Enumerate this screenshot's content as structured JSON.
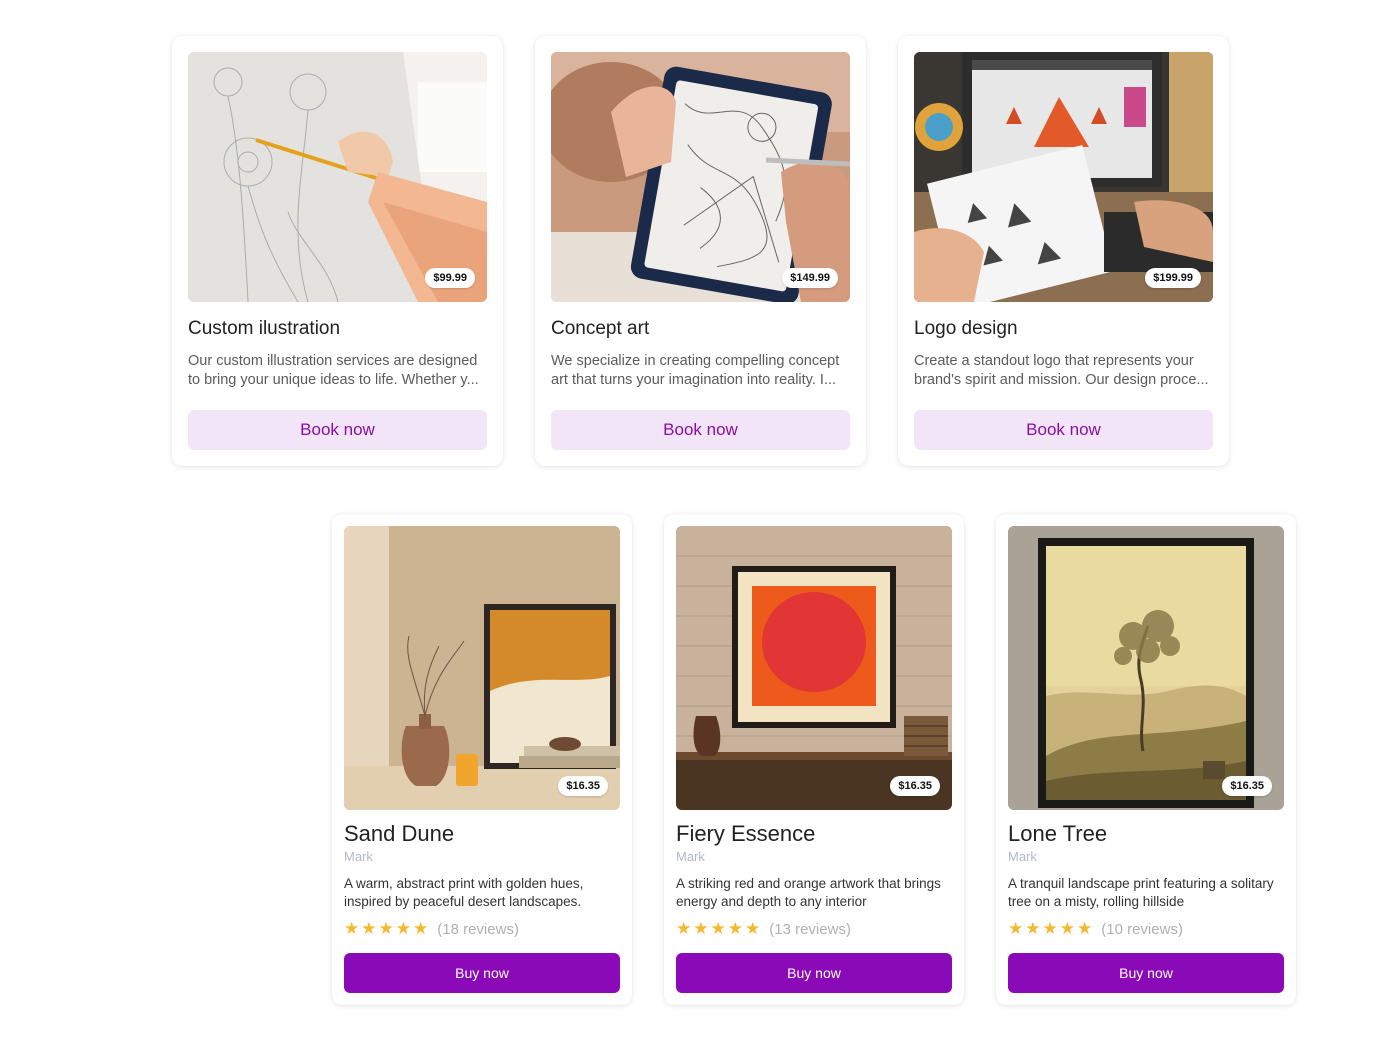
{
  "services": [
    {
      "title": "Custom ilustration",
      "price": "$99.99",
      "description": "Our custom illustration services are designed to bring your unique ideas to life. Whether y...",
      "button": "Book now"
    },
    {
      "title": "Concept art",
      "price": "$149.99",
      "description": "We specialize in creating compelling concept art that turns your imagination into reality. I...",
      "button": "Book now"
    },
    {
      "title": "Logo design",
      "price": "$199.99",
      "description": "Create a standout logo that represents your brand's spirit and mission. Our design proce...",
      "button": "Book now"
    }
  ],
  "products": [
    {
      "title": "Sand Dune",
      "artist": "Mark",
      "price": "$16.35",
      "description": "A warm, abstract print with golden hues, inspired by peaceful desert landscapes.",
      "rating": 5,
      "reviews": "(18 reviews)",
      "button": "Buy now"
    },
    {
      "title": "Fiery Essence",
      "artist": "Mark",
      "price": "$16.35",
      "description": "A striking red and orange artwork that brings energy and depth to any interior",
      "rating": 5,
      "reviews": "(13 reviews)",
      "button": "Buy now"
    },
    {
      "title": "Lone Tree",
      "artist": "Mark",
      "price": "$16.35",
      "description": "A tranquil landscape print featuring a solitary tree on a misty, rolling hillside",
      "rating": 5,
      "reviews": "(10 reviews)",
      "button": "Buy now"
    }
  ],
  "colors": {
    "accent": "#8a0ab8",
    "accent_soft": "#f3e5f8",
    "star": "#f5b82e"
  }
}
